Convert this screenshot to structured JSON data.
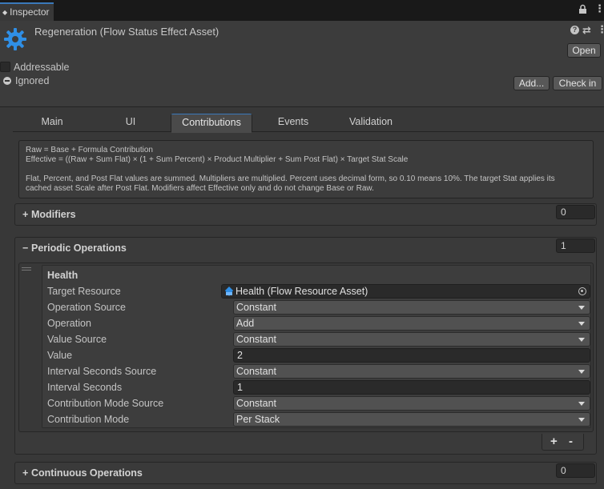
{
  "window": {
    "tab_label": "Inspector",
    "tab_icon": "inspector-dot-icon"
  },
  "header": {
    "title": "Regeneration (Flow Status Effect Asset)",
    "help_glyph": "?",
    "open_label": "Open",
    "addressable_label": "Addressable",
    "ignored_label": "Ignored",
    "add_label": "Add...",
    "check_in_label": "Check in"
  },
  "tabs": [
    {
      "label": "Main",
      "active": false
    },
    {
      "label": "UI",
      "active": false
    },
    {
      "label": "Contributions",
      "active": true
    },
    {
      "label": "Events",
      "active": false
    },
    {
      "label": "Validation",
      "active": false
    }
  ],
  "help": {
    "line1": "Raw = Base + Formula Contribution",
    "line2": "Effective = ((Raw + Sum Flat) × (1 + Sum Percent) × Product Multiplier + Sum Post Flat) × Target Stat Scale",
    "line3": "Flat, Percent, and Post Flat values are summed. Multipliers are multiplied. Percent uses decimal form, so 0.10 means 10%. The target Stat applies its",
    "line4": "cached asset Scale after Post Flat. Modifiers affect Effective only and do not change Base or Raw."
  },
  "modifiers": {
    "sign": "+",
    "label": "Modifiers",
    "count": "0"
  },
  "periodic": {
    "sign": "−",
    "label": "Periodic Operations",
    "count": "1",
    "element": {
      "title": "Health",
      "target_resource_label": "Target Resource",
      "target_resource_value": "Health (Flow Resource Asset)",
      "operation_source_label": "Operation Source",
      "operation_source_value": "Constant",
      "operation_label": "Operation",
      "operation_value": "Add",
      "value_source_label": "Value Source",
      "value_source_value": "Constant",
      "value_label": "Value",
      "value_value": "2",
      "interval_source_label": "Interval Seconds Source",
      "interval_source_value": "Constant",
      "interval_label": "Interval Seconds",
      "interval_value": "1",
      "mode_source_label": "Contribution Mode Source",
      "mode_source_value": "Constant",
      "mode_label": "Contribution Mode",
      "mode_value": "Per Stack"
    },
    "plus": "+",
    "minus": "-"
  },
  "continuous": {
    "sign": "+",
    "label": "Continuous Operations",
    "count": "0"
  },
  "colors": {
    "accent": "#3a79bb",
    "asset_icon": "#2f8fe6",
    "background": "#383838"
  }
}
